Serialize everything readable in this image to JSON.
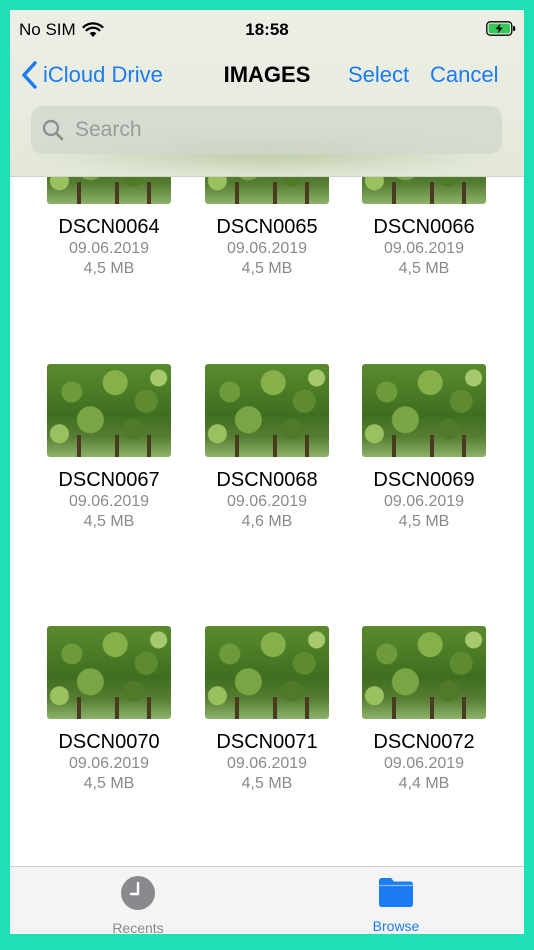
{
  "status": {
    "carrier": "No SIM",
    "time": "18:58"
  },
  "nav": {
    "back_label": "iCloud Drive",
    "title": "IMAGES",
    "select_label": "Select",
    "cancel_label": "Cancel"
  },
  "search": {
    "placeholder": "Search"
  },
  "files": [
    {
      "name": "DSCN0064",
      "date": "09.06.2019",
      "size": "4,5 MB"
    },
    {
      "name": "DSCN0065",
      "date": "09.06.2019",
      "size": "4,5 MB"
    },
    {
      "name": "DSCN0066",
      "date": "09.06.2019",
      "size": "4,5 MB"
    },
    {
      "name": "DSCN0067",
      "date": "09.06.2019",
      "size": "4,5 MB"
    },
    {
      "name": "DSCN0068",
      "date": "09.06.2019",
      "size": "4,6 MB"
    },
    {
      "name": "DSCN0069",
      "date": "09.06.2019",
      "size": "4,5 MB"
    },
    {
      "name": "DSCN0070",
      "date": "09.06.2019",
      "size": "4,5 MB"
    },
    {
      "name": "DSCN0071",
      "date": "09.06.2019",
      "size": "4,5 MB"
    },
    {
      "name": "DSCN0072",
      "date": "09.06.2019",
      "size": "4,4 MB"
    }
  ],
  "tabs": {
    "recents": "Recents",
    "browse": "Browse"
  },
  "colors": {
    "accent": "#1a7cf0",
    "frame": "#1ee0b4",
    "battery": "#34c759"
  },
  "icons": [
    "wifi-icon",
    "battery-charging-icon",
    "chevron-left-icon",
    "search-icon",
    "clock-icon",
    "folder-icon"
  ]
}
